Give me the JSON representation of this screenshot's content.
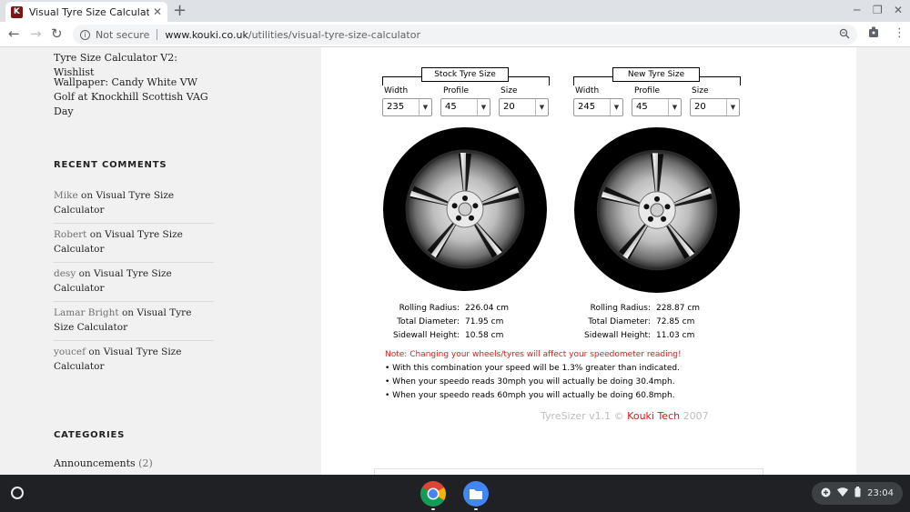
{
  "browser": {
    "tab_title": "Visual Tyre Size Calculator – Ko",
    "favicon_letter": "K",
    "close_glyph": "✕",
    "newtab_glyph": "+",
    "not_secure": "Not secure",
    "url_host": "www.kouki.co.uk",
    "url_path": "/utilities/visual-tyre-size-calculator",
    "icons": [
      "back-icon",
      "forward-icon",
      "reload-icon",
      "info-icon",
      "zoom-icon",
      "extension-icon",
      "avatar-icon",
      "menu-icon"
    ]
  },
  "sidebar": {
    "links_top": [
      "Tyre Size Calculator V2: Wishlist",
      "Wallpaper: Candy White VW Golf at Knockhill Scottish VAG Day"
    ],
    "recent_comments_heading": "RECENT COMMENTS",
    "comments": [
      {
        "author": "Mike",
        "on": " on ",
        "post": "Visual Tyre Size Calculator"
      },
      {
        "author": "Robert",
        "on": " on ",
        "post": "Visual Tyre Size Calculator"
      },
      {
        "author": "desy",
        "on": " on ",
        "post": "Visual Tyre Size Calculator"
      },
      {
        "author": "Lamar Bright",
        "on": " on ",
        "post": "Visual Tyre Size Calculator"
      },
      {
        "author": "youcef",
        "on": " on ",
        "post": "Visual Tyre Size Calculator"
      }
    ],
    "categories_heading": "CATEGORIES",
    "categories": [
      {
        "name": "Announcements",
        "count": "(2)"
      }
    ]
  },
  "calculator": {
    "field_labels": {
      "width": "Width",
      "profile": "Profile",
      "size": "Size"
    },
    "stat_labels": {
      "radius": "Rolling Radius:",
      "diameter": "Total Diameter:",
      "sidewall": "Sidewall Height:"
    },
    "stock": {
      "title": "Stock Tyre Size",
      "width": "235",
      "profile": "45",
      "size": "20",
      "rolling_radius": "226.04 cm",
      "total_diameter": "71.95 cm",
      "sidewall_height": "10.58 cm"
    },
    "new": {
      "title": "New Tyre Size",
      "width": "245",
      "profile": "45",
      "size": "20",
      "rolling_radius": "228.87 cm",
      "total_diameter": "72.85 cm",
      "sidewall_height": "11.03 cm"
    },
    "note_warning": "Note: Changing your wheels/tyres will affect your speedometer reading!",
    "note_lines": [
      "• With this combination your speed will be 1.3% greater than indicated.",
      "• When your speedo reads 30mph you will actually be doing 30.4mph.",
      "• When your speedo reads 60mph you will actually be doing 60.8mph."
    ],
    "credit_prefix": "TyreSizer v1.1 © ",
    "credit_brand": "Kouki Tech",
    "credit_year": " 2007"
  },
  "shelf": {
    "apps": [
      "chrome-app-icon",
      "files-app-icon"
    ],
    "time": "23:04",
    "tray_icons": [
      "add-icon",
      "wifi-icon",
      "battery-icon"
    ]
  },
  "colors": {
    "tab_bar": "#dee1e6",
    "page_bg": "#f1f1f1",
    "warning": "#e01c1c",
    "brand_red": "#d11a1a",
    "shelf": "#202124"
  }
}
